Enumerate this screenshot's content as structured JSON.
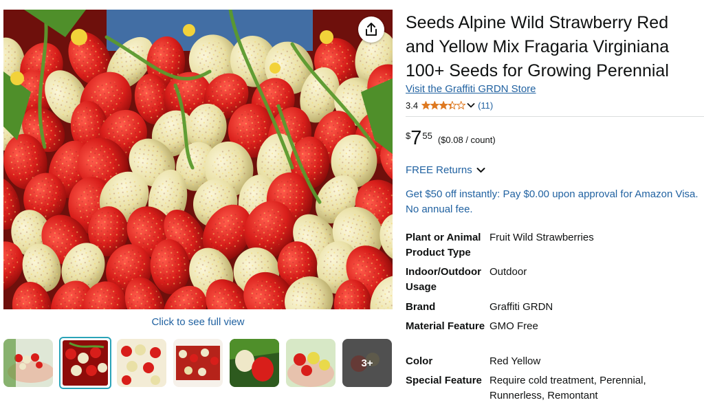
{
  "product": {
    "title": "Seeds Alpine Wild Strawberry Red and Yellow Mix Fragaria Virginiana 100+ Seeds for Growing Perennial",
    "store_link": "Visit the Graffiti GRDN Store",
    "rating_value": "3.4",
    "rating_count": "(11)",
    "stars_filled_fraction": 0.68
  },
  "price": {
    "symbol": "$",
    "whole": "7",
    "fraction": "55",
    "unit_price": "($0.08 / count)"
  },
  "returns": {
    "label": "FREE Returns"
  },
  "promo": {
    "text": "Get $50 off instantly: Pay $0.00 upon approval for Amazon Visa. No annual fee."
  },
  "gallery": {
    "full_view_label": "Click to see full view",
    "more_count": "3+",
    "selected_index": 1
  },
  "specs": [
    {
      "label": "Plant or Animal Product Type",
      "value": "Fruit Wild Strawberries"
    },
    {
      "label": "Indoor/Outdoor Usage",
      "value": "Outdoor"
    },
    {
      "label": "Brand",
      "value": "Graffiti GRDN"
    },
    {
      "label": "Material Feature",
      "value": "GMO Free"
    },
    {
      "label": "Color",
      "value": "Red Yellow"
    },
    {
      "label": "Special Feature",
      "value": "Require cold treatment, Perennial, Runnerless, Remontant"
    }
  ],
  "colors": {
    "link": "#2162a1",
    "star": "#de7921",
    "text": "#0f1111",
    "thumb_border": "#2aa3b8"
  },
  "icons": {
    "share": "share-icon",
    "star": "star-icon",
    "chevron": "chevron-down-icon"
  }
}
